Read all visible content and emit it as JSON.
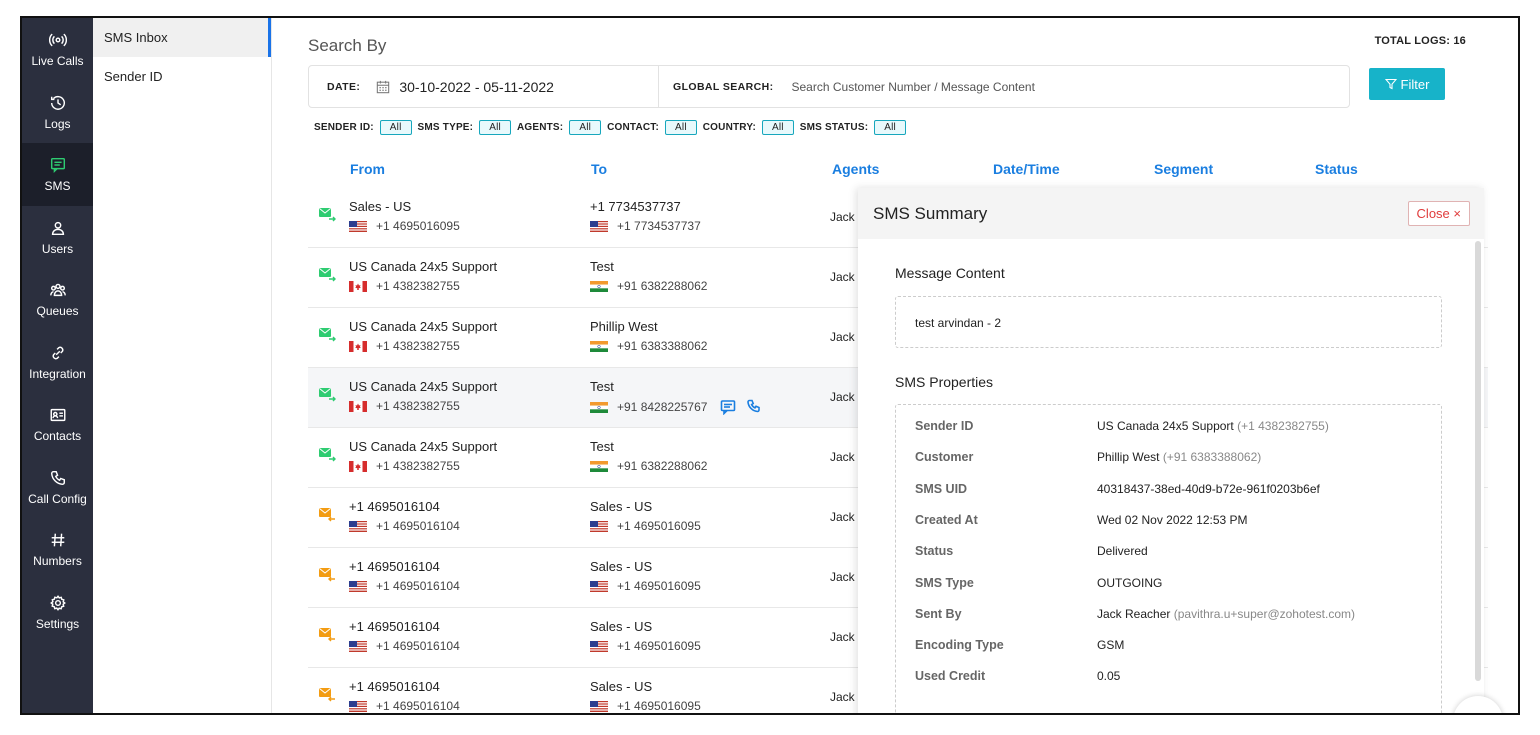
{
  "nav": [
    {
      "label": "Live Calls",
      "icon": "live-calls-icon",
      "active": false
    },
    {
      "label": "Logs",
      "icon": "logs-icon",
      "active": false
    },
    {
      "label": "SMS",
      "icon": "sms-icon",
      "active": true
    },
    {
      "label": "Users",
      "icon": "users-icon",
      "active": false
    },
    {
      "label": "Queues",
      "icon": "queues-icon",
      "active": false
    },
    {
      "label": "Integration",
      "icon": "integration-icon",
      "active": false
    },
    {
      "label": "Contacts",
      "icon": "contacts-icon",
      "active": false
    },
    {
      "label": "Call Config",
      "icon": "call-config-icon",
      "active": false
    },
    {
      "label": "Numbers",
      "icon": "numbers-icon",
      "active": false
    },
    {
      "label": "Settings",
      "icon": "settings-icon",
      "active": false
    }
  ],
  "subnav": [
    {
      "label": "SMS Inbox",
      "active": true
    },
    {
      "label": "Sender ID",
      "active": false
    }
  ],
  "search": {
    "title": "Search By",
    "total_logs": "TOTAL LOGS: 16",
    "date_label": "DATE:",
    "date_value": "30-10-2022 - 05-11-2022",
    "global_label": "GLOBAL SEARCH:",
    "global_placeholder": "Search Customer Number / Message Content",
    "filter_label": "Filter"
  },
  "filters": [
    {
      "label": "SENDER ID:",
      "value": "All"
    },
    {
      "label": "SMS TYPE:",
      "value": "All"
    },
    {
      "label": "AGENTS:",
      "value": "All"
    },
    {
      "label": "CONTACT:",
      "value": "All"
    },
    {
      "label": "COUNTRY:",
      "value": "All"
    },
    {
      "label": "SMS STATUS:",
      "value": "All"
    }
  ],
  "columns": [
    "From",
    "To",
    "Agents",
    "Date/Time",
    "Segment",
    "Status"
  ],
  "rows": [
    {
      "direction": "outgoing",
      "from_name": "Sales - US",
      "from_flag": "us",
      "from_number": "+1 4695016095",
      "to_name": "+1 7734537737",
      "to_flag": "us",
      "to_number": "+1 7734537737",
      "agent": "Jack R"
    },
    {
      "direction": "outgoing",
      "from_name": "US Canada 24x5 Support",
      "from_flag": "ca",
      "from_number": "+1 4382382755",
      "to_name": "Test",
      "to_flag": "in",
      "to_number": "+91 6382288062",
      "agent": "Jack R"
    },
    {
      "direction": "outgoing",
      "from_name": "US Canada 24x5 Support",
      "from_flag": "ca",
      "from_number": "+1 4382382755",
      "to_name": "Phillip West",
      "to_flag": "in",
      "to_number": "+91 6383388062",
      "agent": "Jack R"
    },
    {
      "direction": "outgoing",
      "from_name": "US Canada 24x5 Support",
      "from_flag": "ca",
      "from_number": "+1 4382382755",
      "to_name": "Test",
      "to_flag": "in",
      "to_number": "+91 8428225767",
      "agent": "Jack R",
      "hover": true
    },
    {
      "direction": "outgoing",
      "from_name": "US Canada 24x5 Support",
      "from_flag": "ca",
      "from_number": "+1 4382382755",
      "to_name": "Test",
      "to_flag": "in",
      "to_number": "+91 6382288062",
      "agent": "Jack R"
    },
    {
      "direction": "incoming",
      "from_name": "+1 4695016104",
      "from_flag": "us",
      "from_number": "+1 4695016104",
      "to_name": "Sales - US",
      "to_flag": "us",
      "to_number": "+1 4695016095",
      "agent": "Jack R"
    },
    {
      "direction": "incoming",
      "from_name": "+1 4695016104",
      "from_flag": "us",
      "from_number": "+1 4695016104",
      "to_name": "Sales - US",
      "to_flag": "us",
      "to_number": "+1 4695016095",
      "agent": "Jack R"
    },
    {
      "direction": "incoming",
      "from_name": "+1 4695016104",
      "from_flag": "us",
      "from_number": "+1 4695016104",
      "to_name": "Sales - US",
      "to_flag": "us",
      "to_number": "+1 4695016095",
      "agent": "Jack R"
    },
    {
      "direction": "incoming",
      "from_name": "+1 4695016104",
      "from_flag": "us",
      "from_number": "+1 4695016104",
      "to_name": "Sales - US",
      "to_flag": "us",
      "to_number": "+1 4695016095",
      "agent": "Jack R"
    }
  ],
  "summary": {
    "title": "SMS Summary",
    "close_label": "Close ×",
    "message_title": "Message Content",
    "message": "test arvindan - 2",
    "props_title": "SMS Properties",
    "properties": [
      {
        "key": "Sender ID",
        "value": "US Canada 24x5 Support",
        "sub": "(+1 4382382755)"
      },
      {
        "key": "Customer",
        "value": "Phillip West",
        "sub": "(+91 6383388062)"
      },
      {
        "key": "SMS UID",
        "value": "40318437-38ed-40d9-b72e-961f0203b6ef",
        "sub": ""
      },
      {
        "key": "Created At",
        "value": "Wed 02 Nov 2022 12:53 PM",
        "sub": ""
      },
      {
        "key": "Status",
        "value": "Delivered",
        "sub": ""
      },
      {
        "key": "SMS Type",
        "value": "OUTGOING",
        "sub": ""
      },
      {
        "key": "Sent By",
        "value": "Jack Reacher",
        "sub": "(pavithra.u+super@zohotest.com)"
      },
      {
        "key": "Encoding Type",
        "value": "GSM",
        "sub": ""
      },
      {
        "key": "Used Credit",
        "value": "0.05",
        "sub": ""
      }
    ]
  },
  "colors": {
    "accent": "#1a7ee0",
    "filter_button": "#17b3c9",
    "nav_bg": "#2b2f3e",
    "nav_active": "#2ecc71",
    "outgoing": "#2ecc71",
    "incoming": "#f39c12",
    "close": "#e03c3c"
  }
}
